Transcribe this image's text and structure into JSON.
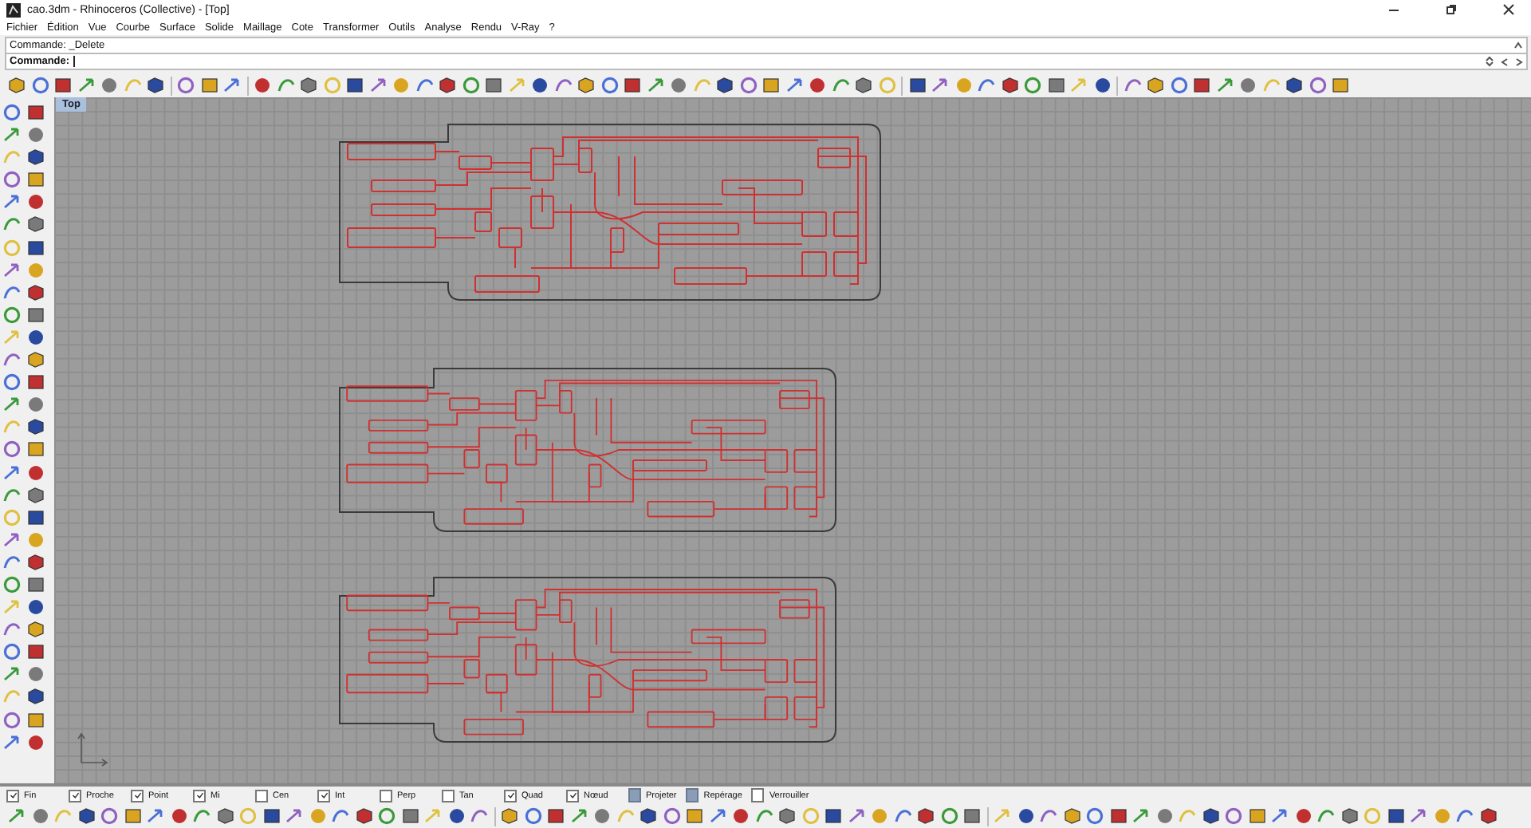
{
  "window": {
    "title": "cao.3dm - Rhinoceros (Collective) - [Top]"
  },
  "menu": [
    "Fichier",
    "Édition",
    "Vue",
    "Courbe",
    "Surface",
    "Solide",
    "Maillage",
    "Cote",
    "Transformer",
    "Outils",
    "Analyse",
    "Rendu",
    "V-Ray",
    "?"
  ],
  "command_history": "Commande: _Delete",
  "command_prompt": {
    "label": "Commande:"
  },
  "viewport": {
    "title": "Top",
    "selected": true
  },
  "osnaps": [
    {
      "label": "Fin",
      "kind": "checkbox",
      "checked": true
    },
    {
      "label": "Proche",
      "kind": "checkbox",
      "checked": true
    },
    {
      "label": "Point",
      "kind": "checkbox",
      "checked": true
    },
    {
      "label": "Mi",
      "kind": "checkbox",
      "checked": true
    },
    {
      "label": "Cen",
      "kind": "checkbox",
      "checked": false
    },
    {
      "label": "Int",
      "kind": "checkbox",
      "checked": true
    },
    {
      "label": "Perp",
      "kind": "checkbox",
      "checked": false
    },
    {
      "label": "Tan",
      "kind": "checkbox",
      "checked": false
    },
    {
      "label": "Quad",
      "kind": "checkbox",
      "checked": true
    },
    {
      "label": "Nœud",
      "kind": "checkbox",
      "checked": true
    },
    {
      "label": "Projeter",
      "kind": "toggle",
      "checked": true
    },
    {
      "label": "Repérage",
      "kind": "toggle",
      "checked": true
    },
    {
      "label": "Verrouiller",
      "kind": "toggle",
      "checked": false
    }
  ]
}
